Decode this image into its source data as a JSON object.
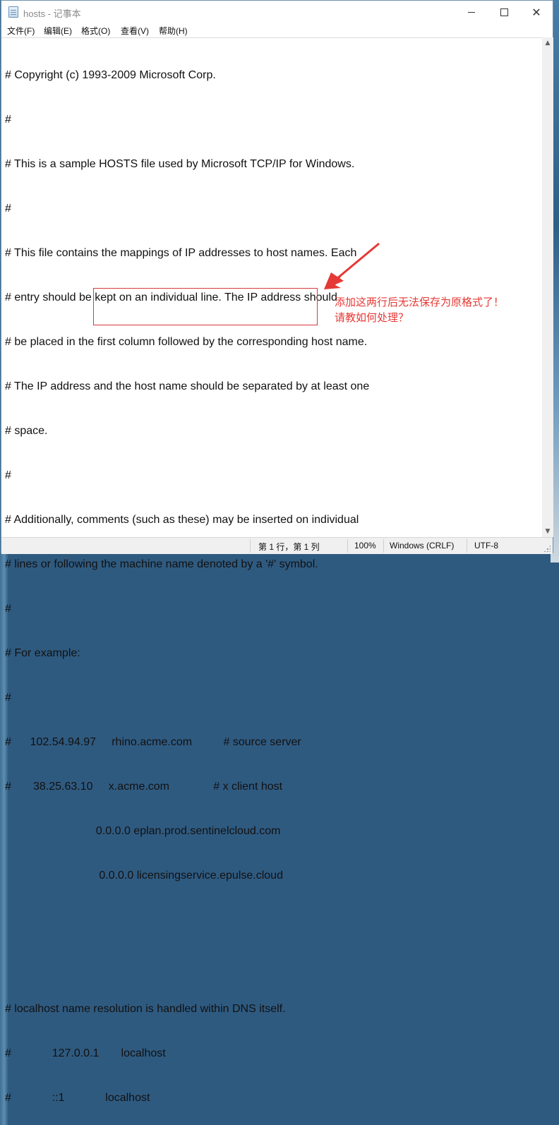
{
  "window": {
    "title": "hosts - 记事本",
    "close_glyph": "✕"
  },
  "menu": [
    "文件(F)",
    "编辑(E)",
    "格式(O)",
    "查看(V)",
    "帮助(H)"
  ],
  "editor": {
    "lines": [
      "# Copyright (c) 1993-2009 Microsoft Corp.",
      "#",
      "# This is a sample HOSTS file used by Microsoft TCP/IP for Windows.",
      "#",
      "# This file contains the mappings of IP addresses to host names. Each",
      "# entry should be kept on an individual line. The IP address should",
      "# be placed in the first column followed by the corresponding host name.",
      "# The IP address and the host name should be separated by at least one",
      "# space.",
      "#",
      "# Additionally, comments (such as these) may be inserted on individual",
      "# lines or following the machine name denoted by a '#' symbol.",
      "#",
      "# For example:",
      "#",
      "#      102.54.94.97     rhino.acme.com          # source server",
      "#       38.25.63.10     x.acme.com              # x client host",
      "                             0.0.0.0 eplan.prod.sentinelcloud.com",
      "                              0.0.0.0 licensingservice.epulse.cloud",
      "",
      "",
      "# localhost name resolution is handled within DNS itself.",
      "#             127.0.0.1       localhost",
      "#             ::1             localhost"
    ]
  },
  "annotation": {
    "line1": "添加这两行后无法保存为原格式了！",
    "line2": "请教如何处理？",
    "color": "#e53935"
  },
  "statusbar": {
    "position": "第 1 行，第 1 列",
    "zoom": "100%",
    "line_ending": "Windows (CRLF)",
    "encoding": "UTF-8"
  }
}
